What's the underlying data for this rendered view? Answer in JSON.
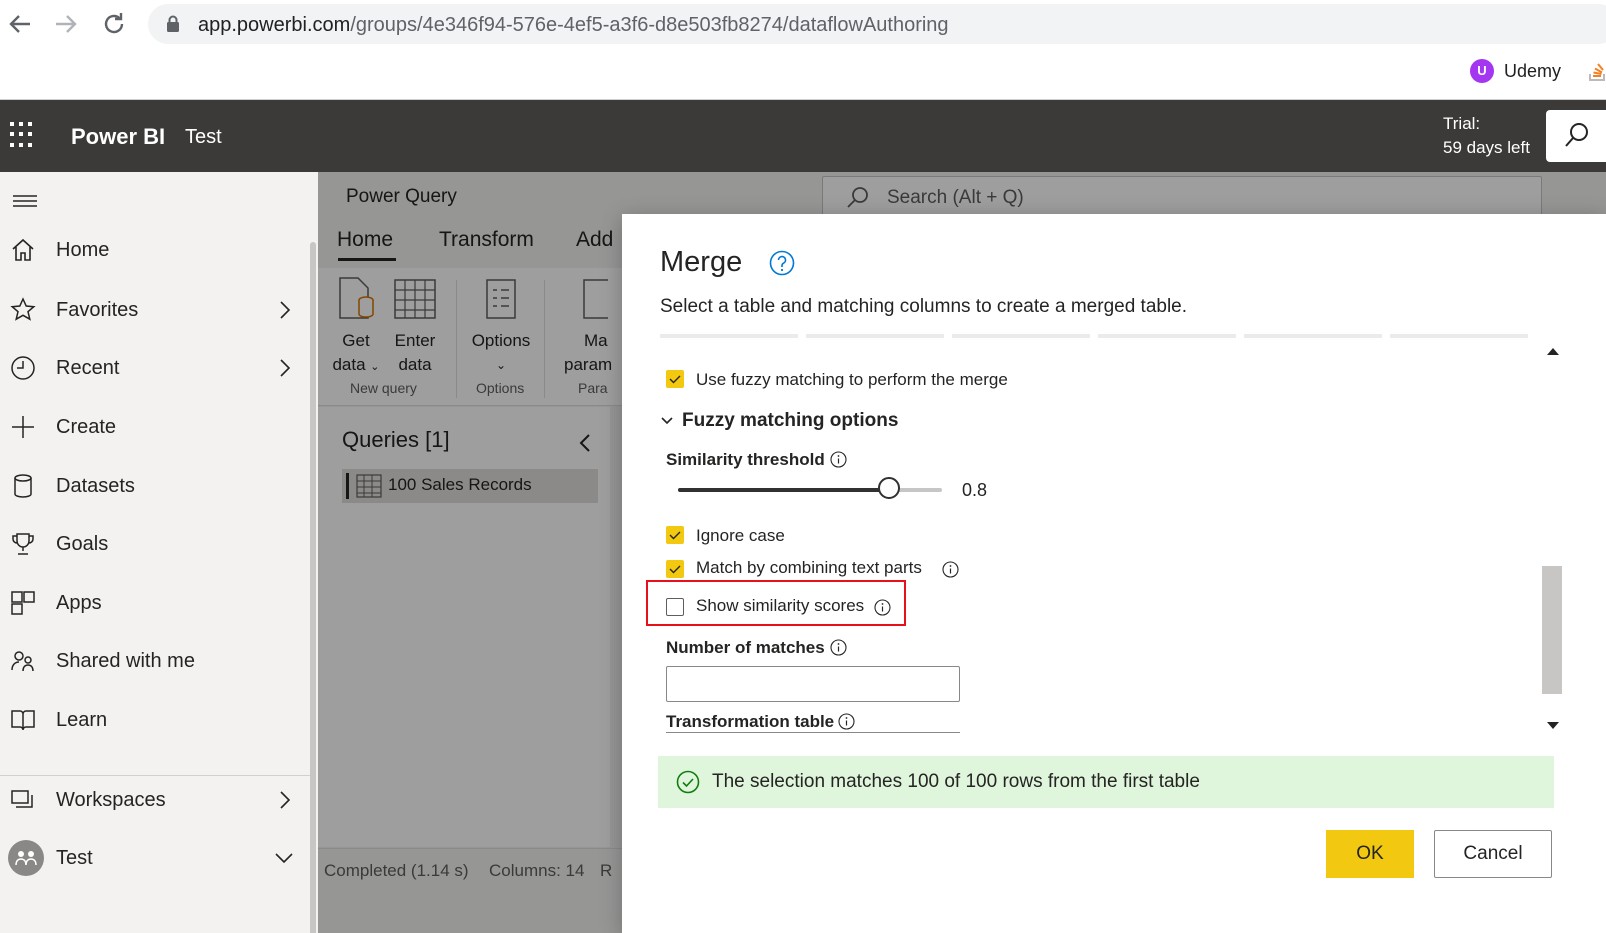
{
  "browser": {
    "url_host": "app.powerbi.com",
    "url_path": "/groups/4e346f94-576e-4ef5-a3f6-d8e503fb8274/dataflowAuthoring",
    "bookmark_label": "Udemy",
    "bookmark_logo_letter": "U"
  },
  "header": {
    "brand": "Power BI",
    "workspace": "Test",
    "trial_line1": "Trial:",
    "trial_line2": "59 days left"
  },
  "nav": {
    "items": [
      {
        "label": "Home",
        "icon": "home-icon"
      },
      {
        "label": "Favorites",
        "icon": "star-icon"
      },
      {
        "label": "Recent",
        "icon": "clock-icon"
      },
      {
        "label": "Create",
        "icon": "plus-icon"
      },
      {
        "label": "Datasets",
        "icon": "database-icon"
      },
      {
        "label": "Goals",
        "icon": "trophy-icon"
      },
      {
        "label": "Apps",
        "icon": "apps-icon"
      },
      {
        "label": "Shared with me",
        "icon": "shared-icon"
      },
      {
        "label": "Learn",
        "icon": "book-icon"
      },
      {
        "label": "Workspaces",
        "icon": "workspaces-icon"
      },
      {
        "label": "Test",
        "icon": "group-avatar-icon"
      }
    ]
  },
  "power_query": {
    "title": "Power Query",
    "search_placeholder": "Search (Alt + Q)",
    "tabs": [
      "Home",
      "Transform",
      "Add"
    ],
    "ribbon": {
      "get_data_1": "Get",
      "get_data_2": "data",
      "enter_data_1": "Enter",
      "enter_data_2": "data",
      "options": "Options",
      "manage_1": "Ma",
      "manage_2": "param",
      "group_new_query": "New query",
      "group_options": "Options",
      "group_params": "Para"
    },
    "queries_title": "Queries [1]",
    "query_item": "100 Sales Records",
    "status_completed": "Completed (1.14 s)",
    "status_columns": "Columns: 14",
    "status_rows": "R"
  },
  "merge_dialog": {
    "title": "Merge",
    "subtitle": "Select a table and matching columns to create a merged table.",
    "use_fuzzy_label": "Use fuzzy matching to perform the merge",
    "use_fuzzy_checked": true,
    "fuzzy_section_title": "Fuzzy matching options",
    "similarity_label": "Similarity threshold",
    "similarity_value": "0.8",
    "similarity_fraction": 0.8,
    "ignore_case_label": "Ignore case",
    "ignore_case_checked": true,
    "combine_text_label": "Match by combining text parts",
    "combine_text_checked": true,
    "show_scores_label": "Show similarity scores",
    "show_scores_checked": false,
    "number_of_matches_label": "Number of matches",
    "number_of_matches_value": "",
    "transformation_table_label": "Transformation table",
    "match_message": "The selection matches 100 of 100 rows from the first table",
    "ok_label": "OK",
    "cancel_label": "Cancel"
  },
  "colors": {
    "accent_yellow": "#f2c811",
    "header_dark": "#3b3a39",
    "highlight_red": "#e8111b",
    "success_bg": "#dff6dd",
    "success_icon": "#107c10"
  }
}
